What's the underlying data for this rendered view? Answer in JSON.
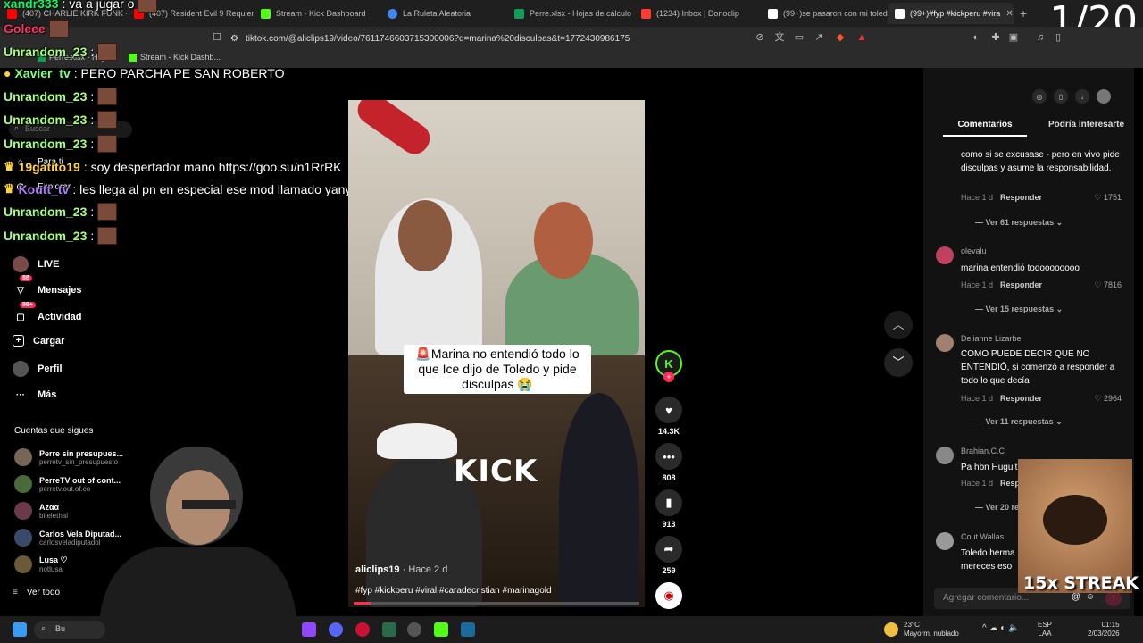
{
  "counter": "1/20",
  "tabs": [
    {
      "label": "(407) CHARLIE KIRK FUNK - (ai...",
      "color": "#ff0000"
    },
    {
      "label": "(407) Resident Evil 9 Requiem",
      "color": "#ff0000"
    },
    {
      "label": "Stream - Kick Dashboard",
      "color": "#53fc18"
    },
    {
      "label": "La Ruleta Aleatoria",
      "color": "#4285f4"
    },
    {
      "label": "Perre.xlsx - Hojas de cálculo de",
      "color": "#0f9d58"
    },
    {
      "label": "(1234) Inbox | Donoclip",
      "color": "#ff3b30"
    },
    {
      "label": "(99+)se pasaron con mi toledo",
      "color": "#ffffff"
    },
    {
      "label": "(99+)#fyp #kickperu #vira",
      "color": "#ffffff"
    }
  ],
  "address": {
    "url": "tiktok.com/@aliclips19/video/7611746603715300006?q=marina%20disculpas&t=1772430986175"
  },
  "bookmarks": [
    {
      "label": "Perre.xlsx - Hoja"
    },
    {
      "label": "Stream - Kick Dashb..."
    }
  ],
  "chat": [
    {
      "user": "xandr333",
      "msg": ": va a jugar o",
      "color": "#00ff66"
    },
    {
      "user": "Goleee",
      "msg": "",
      "color": "#ff3366"
    },
    {
      "user": "Unrandom_23",
      "msg": ":",
      "color": "#a6ff7a"
    },
    {
      "user": "Xavier_tv",
      "msg": ": PERO PARCHA PE SAN ROBERTO",
      "color": "#7dff7d"
    },
    {
      "user": "Unrandom_23",
      "msg": ":",
      "color": "#a6ff7a"
    },
    {
      "user": "Unrandom_23",
      "msg": ":",
      "color": "#a6ff7a"
    },
    {
      "user": "Unrandom_23",
      "msg": ":",
      "color": "#a6ff7a"
    },
    {
      "user": "19gatito19",
      "msg": ": soy despertador mano https://goo.su/n1RrRK",
      "color": "#ffd23f"
    },
    {
      "user": "Koutt_tv",
      "msg": ": les llega al pn en especial ese mod llamado yanyo",
      "color": "#b07cff"
    },
    {
      "user": "Unrandom_23",
      "msg": ":",
      "color": "#a6ff7a"
    },
    {
      "user": "Unrandom_23",
      "msg": ":",
      "color": "#a6ff7a"
    }
  ],
  "sidebar": {
    "search_placeholder": "Buscar",
    "items": [
      {
        "label": "Para ti"
      },
      {
        "label": "Explorar"
      },
      {
        "label": "LIVE"
      },
      {
        "label": "Mensajes",
        "badge": "88"
      },
      {
        "label": "Actividad",
        "badge": "99+"
      },
      {
        "label": "Cargar"
      },
      {
        "label": "Perfil"
      },
      {
        "label": "Más"
      }
    ],
    "following_title": "Cuentas que sigues",
    "following": [
      {
        "name": "Perre sin presupues...",
        "handle": "perretv_sin_presupuesto"
      },
      {
        "name": "PerreTV out of cont...",
        "handle": "perretv.out.of.co"
      },
      {
        "name": "Azαα",
        "handle": "bitelethal"
      },
      {
        "name": "Carlos Vela Diputad...",
        "handle": "carlosveladiputadol"
      },
      {
        "name": "Lusa ♡",
        "handle": "notlusa"
      }
    ],
    "see_all": "Ver todo"
  },
  "video": {
    "caption": "🚨Marina no entendió todo lo que Ice dijo de Toledo y pide disculpas 😭",
    "overlay_text": "KICK",
    "author": "aliclips19",
    "posted": " · Hace 2 d",
    "tags": "#fyp #kickperu #viral #caradecristian #marinagold",
    "progress": 0.06
  },
  "actions": {
    "likes": "14.3K",
    "comments": "808",
    "saves": "913",
    "shares": "259"
  },
  "panel": {
    "tab_comments": "Comentarios",
    "tab_interest": "Podría interesarte",
    "add_placeholder": "Agregar comentario...",
    "comments": [
      {
        "user": "",
        "text": "como si se excusase - pero en vivo pide disculpas y asume la responsabilidad.",
        "time": "Hace 1 d",
        "reply": "Responder",
        "likes": "1751",
        "more": "Ver 61 respuestas"
      },
      {
        "user": "olevalu",
        "text": "marina entendió todoooooooo",
        "time": "Hace 1 d",
        "reply": "Responder",
        "likes": "7816",
        "more": "Ver 15 respuestas"
      },
      {
        "user": "Delianne Lizarbe",
        "text": "COMO PUEDE DECIR QUE NO ENTENDIÓ, si comenzó a responder a todo lo que decía",
        "time": "Hace 1 d",
        "reply": "Responder",
        "likes": "2964",
        "more": "Ver 11 respuestas"
      },
      {
        "user": "Brahian.C.C",
        "text": "Pa hbn Huguit",
        "time": "Hace 1 d",
        "reply": "Respo",
        "likes": "",
        "more": "Ver 20 re"
      },
      {
        "user": "Cout Wallas",
        "text": "Toledo herma mereces eso",
        "time": "",
        "reply": "",
        "likes": "",
        "more": ""
      }
    ]
  },
  "streak": "15x STREAK",
  "taskbar": {
    "search": "Bu",
    "weather_temp": "23°C",
    "weather_desc": "Mayorm. nublado",
    "lang": "ESP",
    "region": "LAA",
    "time": "01:15",
    "date": "2/03/2026"
  }
}
